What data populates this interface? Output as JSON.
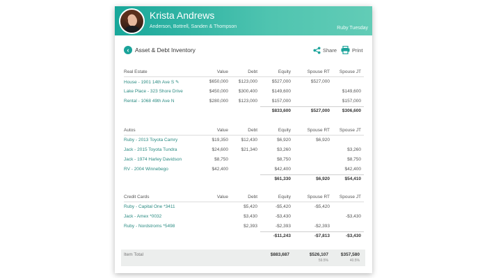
{
  "header": {
    "name": "Krista Andrews",
    "firm": "Anderson, Bottrell, Sanden & Thompson",
    "client": "Ruby Tuesday"
  },
  "toolbar": {
    "title": "Asset & Debt Inventory",
    "share_label": "Share",
    "print_label": "Print"
  },
  "columns": {
    "value": "Value",
    "debt": "Debt",
    "equity": "Equity",
    "spouse_rt": "Spouse RT",
    "spouse_jt": "Spouse JT"
  },
  "sections": [
    {
      "title": "Real Estate",
      "rows": [
        {
          "label": "House - 1901 14th Ave S ✎",
          "value": "$650,000",
          "debt": "$123,000",
          "equity": "$527,000",
          "spouse_rt": "$527,000",
          "spouse_jt": ""
        },
        {
          "label": "Lake Place - 323 Shore Drive",
          "value": "$450,000",
          "debt": "$300,400",
          "equity": "$149,600",
          "spouse_rt": "",
          "spouse_jt": "$149,600"
        },
        {
          "label": "Rental - 1068 49th Ave N",
          "value": "$280,000",
          "debt": "$123,000",
          "equity": "$157,000",
          "spouse_rt": "",
          "spouse_jt": "$157,000"
        }
      ],
      "total": {
        "equity": "$833,600",
        "spouse_rt": "$527,000",
        "spouse_jt": "$306,600"
      }
    },
    {
      "title": "Autos",
      "rows": [
        {
          "label": "Ruby - 2013 Toyota Camry",
          "value": "$19,350",
          "debt": "$12,430",
          "equity": "$6,920",
          "spouse_rt": "$6,920",
          "spouse_jt": ""
        },
        {
          "label": "Jack - 2015 Toyota Tundra",
          "value": "$24,600",
          "debt": "$21,340",
          "equity": "$3,260",
          "spouse_rt": "",
          "spouse_jt": "$3,260"
        },
        {
          "label": "Jack - 1974 Harley Davidson",
          "value": "$8,750",
          "debt": "",
          "equity": "$8,750",
          "spouse_rt": "",
          "spouse_jt": "$8,750"
        },
        {
          "label": "RV - 2004 Winnebego",
          "value": "$42,400",
          "debt": "",
          "equity": "$42,400",
          "spouse_rt": "",
          "spouse_jt": "$42,400"
        }
      ],
      "total": {
        "equity": "$61,330",
        "spouse_rt": "$6,920",
        "spouse_jt": "$54,410"
      }
    },
    {
      "title": "Credit Cards",
      "rows": [
        {
          "label": "Ruby - Capital One *3411",
          "value": "",
          "debt": "$5,420",
          "equity": "-$5,420",
          "spouse_rt": "-$5,420",
          "spouse_jt": ""
        },
        {
          "label": "Jack - Amex *0032",
          "value": "",
          "debt": "$3,430",
          "equity": "-$3,430",
          "spouse_rt": "",
          "spouse_jt": "-$3,430"
        },
        {
          "label": "Ruby - Nordstroms *5498",
          "value": "",
          "debt": "$2,393",
          "equity": "-$2,393",
          "spouse_rt": "-$2,393",
          "spouse_jt": ""
        }
      ],
      "total": {
        "equity": "-$11,243",
        "spouse_rt": "-$7,813",
        "spouse_jt": "-$3,430"
      }
    }
  ],
  "grand_total": {
    "label": "Item Total",
    "equity": "$883,687",
    "spouse_rt": "$526,107",
    "spouse_jt": "$357,580",
    "spouse_rt_pct": "59.5%",
    "spouse_jt_pct": "40.5%"
  }
}
